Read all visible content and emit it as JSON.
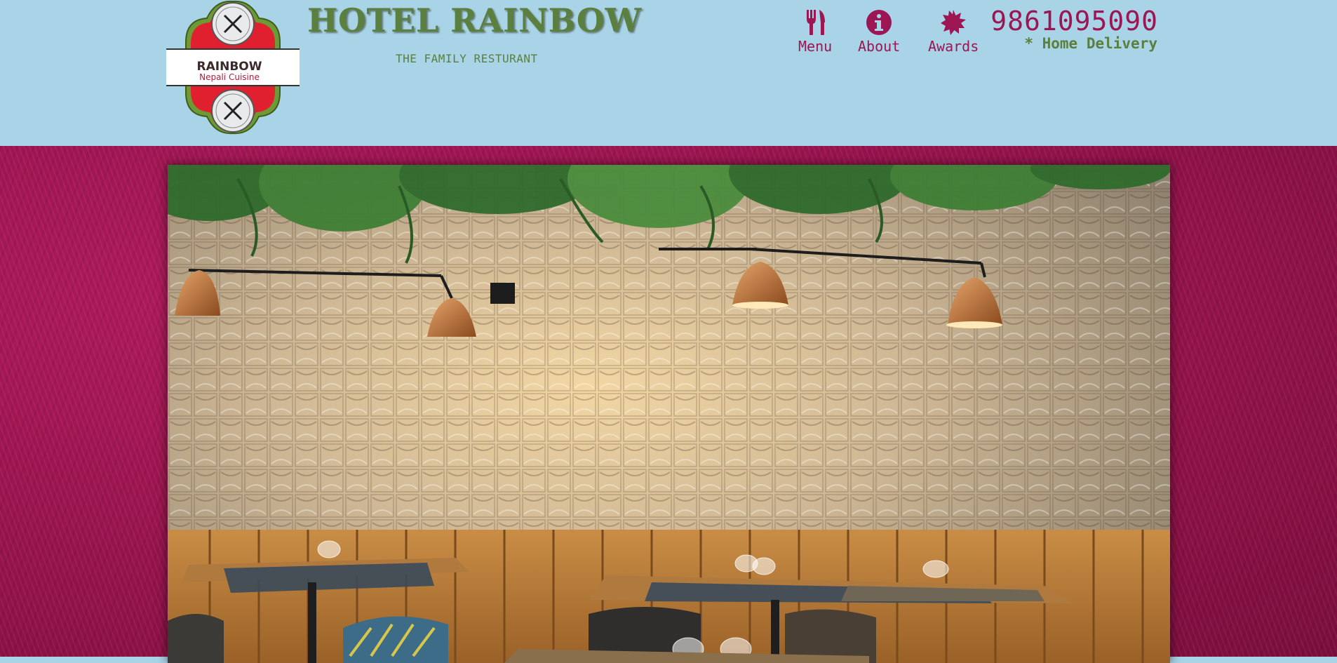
{
  "header": {
    "logo": {
      "name": "RAINBOW",
      "tagline": "Nepali Cuisine"
    },
    "title": "HOTEL RAINBOW",
    "subtitle": "THE FAMILY RESTURANT",
    "nav": [
      {
        "label": "Menu",
        "icon": "fork-knife-icon"
      },
      {
        "label": "About",
        "icon": "info-icon"
      },
      {
        "label": "Awards",
        "icon": "award-badge-icon"
      }
    ],
    "phone": "9861095090",
    "delivery": "* Home Delivery"
  },
  "colors": {
    "header_bg": "#a9d3e6",
    "accent": "#9b1652",
    "brand_green": "#5b7f3f",
    "page_bg": "#93124a"
  },
  "hero": {
    "image": "restaurant-interior-photo"
  }
}
